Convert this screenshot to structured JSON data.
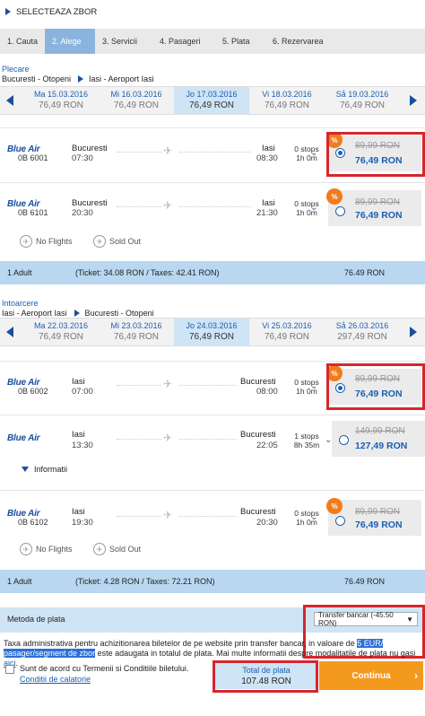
{
  "header": {
    "title": "SELECTEAZA ZBOR"
  },
  "steps": [
    "1. Cauta",
    "2. Alege",
    "3. Servicii",
    "4. Pasageri",
    "5. Plata",
    "6. Rezervarea"
  ],
  "outbound": {
    "label": "Plecare",
    "from": "Bucuresti - Otopeni",
    "to": "Iasi - Aeroport Iasi",
    "days": [
      {
        "date": "Ma 15.03.2016",
        "price": "76,49 RON"
      },
      {
        "date": "Mi 16.03.2016",
        "price": "76,49 RON"
      },
      {
        "date": "Jo 17.03.2016",
        "price": "76,49 RON"
      },
      {
        "date": "Vi 18.03.2016",
        "price": "76,49 RON"
      },
      {
        "date": "Så 19.03.2016",
        "price": "76,49 RON"
      }
    ],
    "flights": [
      {
        "airline": "Blue Air",
        "number": "0B 6001",
        "from": "Bucuresti",
        "dep": "07:30",
        "to": "Iasi",
        "arr": "08:30",
        "stops": "0 stops",
        "duration": "1h 0m",
        "old": "89,99 RON",
        "new": "76,49 RON",
        "badge": "%"
      },
      {
        "airline": "Blue Air",
        "number": "0B 6101",
        "from": "Bucuresti",
        "dep": "20:30",
        "to": "Iasi",
        "arr": "21:30",
        "stops": "0 stops",
        "duration": "1h 0m",
        "old": "89,99 RON",
        "new": "76,49 RON",
        "badge": "%"
      }
    ],
    "legend": {
      "no_flights": "No Flights",
      "sold_out": "Sold Out"
    },
    "summary": {
      "adults": "1 Adult",
      "detail": "(Ticket: 34.08 RON / Taxes: 42.41 RON)",
      "total": "76.49 RON"
    }
  },
  "inbound": {
    "label": "Intoarcere",
    "from": "Iasi - Aeroport Iasi",
    "to": "Bucuresti - Otopeni",
    "days": [
      {
        "date": "Ma 22.03.2016",
        "price": "76,49 RON"
      },
      {
        "date": "Mi 23.03.2016",
        "price": "76,49 RON"
      },
      {
        "date": "Jo 24.03.2016",
        "price": "76,49 RON"
      },
      {
        "date": "Vi 25.03.2016",
        "price": "76,49 RON"
      },
      {
        "date": "Så 26.03.2016",
        "price": "297,49 RON"
      }
    ],
    "flights": [
      {
        "airline": "Blue Air",
        "number": "0B 6002",
        "from": "Iasi",
        "dep": "07:00",
        "to": "Bucuresti",
        "arr": "08:00",
        "stops": "0 stops",
        "duration": "1h 0m",
        "old": "89,99 RON",
        "new": "76,49 RON",
        "badge": "%"
      },
      {
        "airline": "Blue Air",
        "number": "",
        "from": "Iasi",
        "dep": "13:30",
        "to": "Bucuresti",
        "arr": "22:05",
        "stops": "1 stops",
        "duration": "8h 35m",
        "old": "149,99 RON",
        "new": "127,49 RON",
        "badge": ""
      },
      {
        "airline": "Blue Air",
        "number": "0B 6102",
        "from": "Iasi",
        "dep": "19:30",
        "to": "Bucuresti",
        "arr": "20:30",
        "stops": "0 stops",
        "duration": "1h 0m",
        "old": "89,99 RON",
        "new": "76,49 RON",
        "badge": "%"
      }
    ],
    "info_label": "Informatii",
    "legend": {
      "no_flights": "No Flights",
      "sold_out": "Sold Out"
    },
    "summary": {
      "adults": "1 Adult",
      "detail": "(Ticket: 4.28 RON / Taxes: 72.21 RON)",
      "total": "76.49 RON"
    }
  },
  "payment": {
    "label": "Metoda de plata",
    "selected": "Transfer bancar (-45.50 RON)"
  },
  "tax": {
    "part1": "Taxa administrativa pentru achizitionarea biletelor de pe website prin transfer bancar, in valoare de ",
    "highlight": "5 EUR/ pasager/segment de zbor",
    "part2": " este adaugata in totalul de plata. Mai multe informatii despre modalitatile de plata nu ",
    "part3": "gasi ",
    "link": "aici",
    "end": "."
  },
  "terms": {
    "label": "Sunt de acord cu Termenii si Conditiile biletului.",
    "link": "Conditii de calatorie"
  },
  "total": {
    "label": "Total de plata",
    "value": "107.48 RON"
  },
  "continue_label": "Continua",
  "colors": {
    "accent": "#1a5fb4",
    "highlight_box": "#d6262c",
    "button": "#f39a1e",
    "badge": "#f07c1b"
  }
}
